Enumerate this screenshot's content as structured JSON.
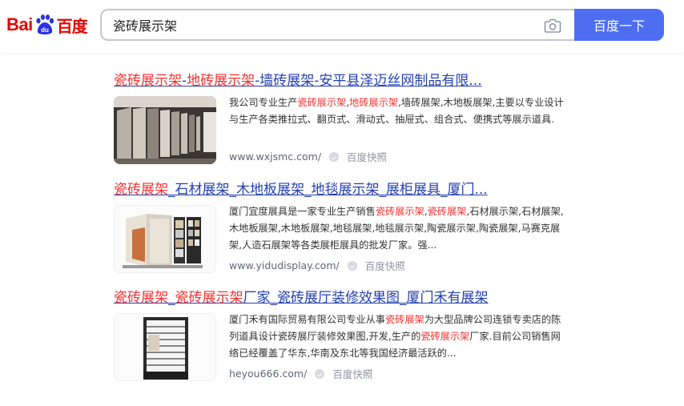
{
  "header": {
    "logo_latin": "Bai",
    "logo_paw_text": "du",
    "logo_chinese": "百度",
    "search": {
      "value": "瓷砖展示架"
    },
    "search_button_label": "百度一下",
    "camera_icon": "camera-icon"
  },
  "colors": {
    "link": "#2440b3",
    "highlight": "#f73131",
    "button": "#4e6ef2",
    "logo": "#e10602"
  },
  "results": [
    {
      "title_parts": [
        "瓷砖展示架",
        "-",
        "地砖展示架",
        "-墙砖展架-安平县泽迈丝网制品有限..."
      ],
      "description_parts": [
        "我公司专业生产",
        "瓷砖展示架",
        ",",
        "地砖展示架",
        ",墙砖展架,木地板展架,主要以专业设计与生产各类推拉式、翻页式、滑动式、抽屉式、组合式、便携式等展示道具."
      ],
      "url": "www.wxjsmc.com/",
      "snapshot": "百度快照"
    },
    {
      "title_parts": [
        "瓷砖展架",
        "_石材展架_木地板展架_地毯展示架_展柜展具_厦门..."
      ],
      "description_parts": [
        "厦门宜度展具是一家专业生产销售",
        "瓷砖展示架",
        ",",
        "瓷砖展架",
        ",石材展示架,石材展架,木地板展架,木地板展架,地毯展架,地毯展示架,陶瓷展示架,陶瓷展架,马赛克展架,人造石展架等各类展柜展具的批发厂家。强..."
      ],
      "url": "www.yidudisplay.com/",
      "snapshot": "百度快照"
    },
    {
      "title_parts": [
        "瓷砖展架",
        "_",
        "瓷砖展示架",
        "厂家_瓷砖展厅装修效果图_厦门禾有展架"
      ],
      "description_parts": [
        "厦门禾有国际贸易有限公司专业从事",
        "瓷砖展架",
        "为大型品牌公司连锁专卖店的陈列道具设计瓷砖展厅装修效果图,开发,生产的",
        "瓷砖展示架",
        "厂家.目前公司销售网络已经覆盖了华东,华南及东北等我国经济最活跃的..."
      ],
      "url": "heyou666.com/",
      "snapshot": "百度快照"
    }
  ]
}
